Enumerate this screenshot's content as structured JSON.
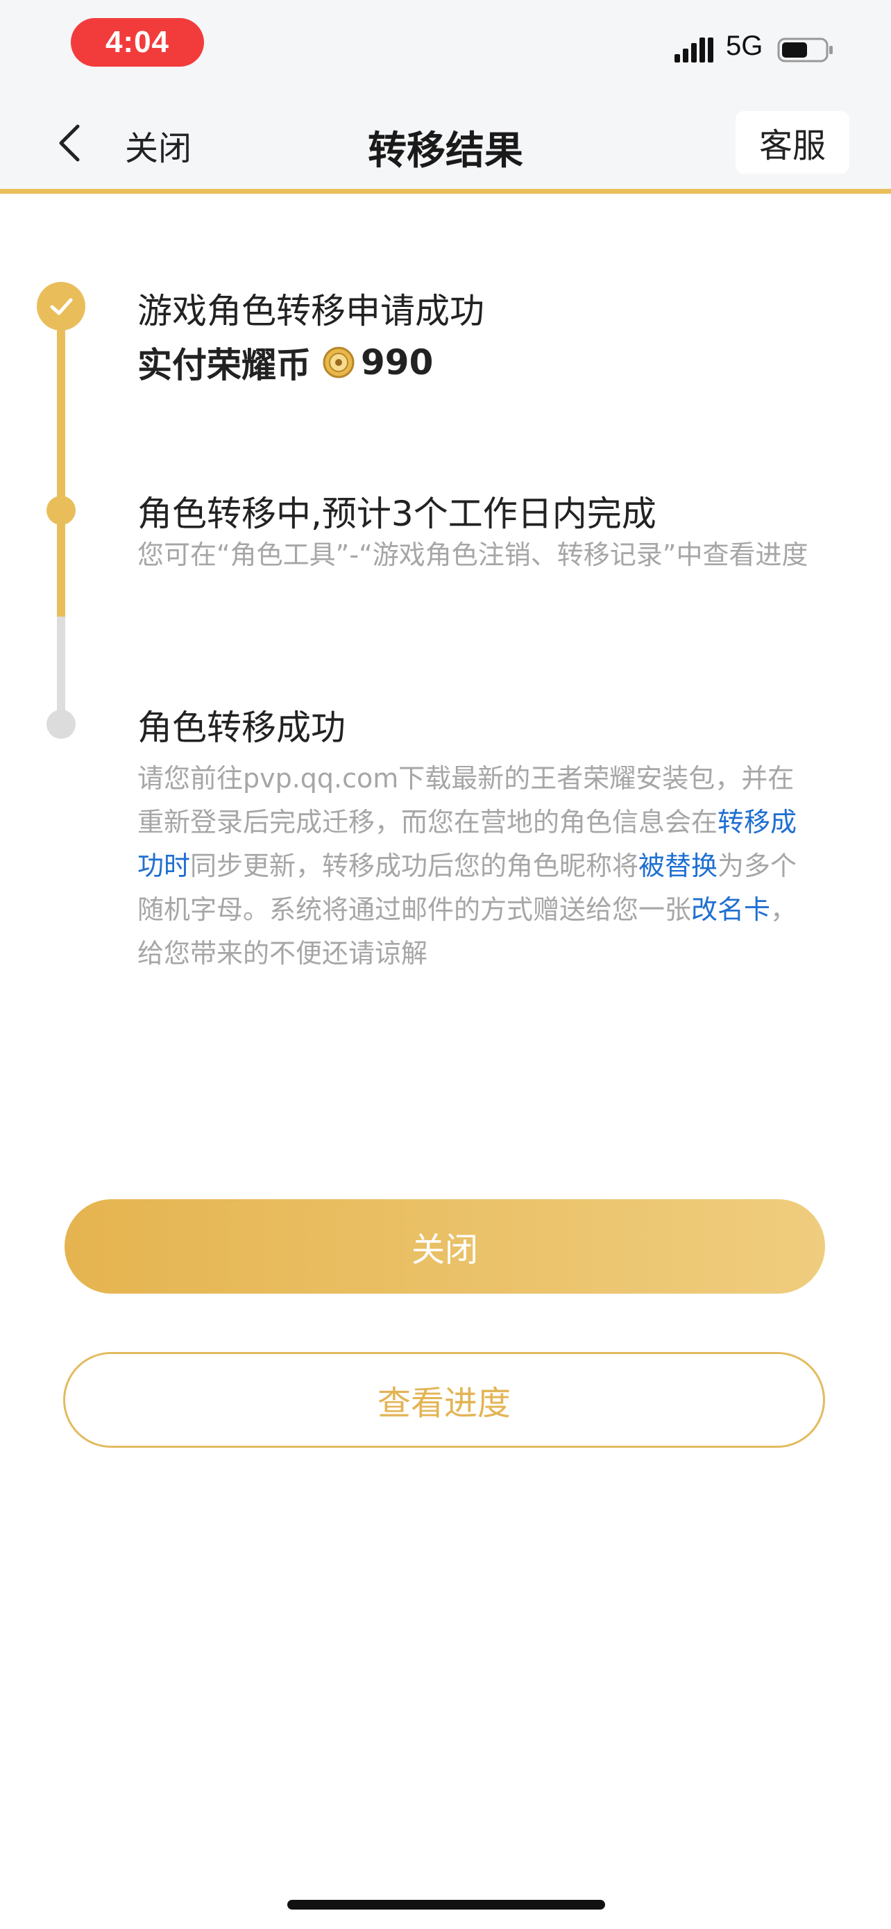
{
  "status_bar": {
    "time": "4:04",
    "network": "5G",
    "time_pill_color": "#f23c3c",
    "battery_level": 0.6
  },
  "nav": {
    "close_label": "关闭",
    "title": "转移结果",
    "service_label": "客服"
  },
  "accent_color": "#e9be5a",
  "link_color": "#1f6fd1",
  "timeline": {
    "step1": {
      "title": "游戏角色转移申请成功",
      "sub_label": "实付荣耀币",
      "amount": "990",
      "status": "done",
      "icon": "check-icon"
    },
    "step2": {
      "title": "角色转移中,预计3个工作日内完成",
      "desc": "您可在“角色工具”-“游戏角色注销、转移记录”中查看进度",
      "status": "current"
    },
    "step3": {
      "title": "角色转移成功",
      "desc_parts": [
        "请您前往pvp.qq.com下载最新的王者荣耀安装包，并在重新登录后完成迁移，而您在营地的角色信息会在",
        "转移成功时",
        "同步更新，转移成功后您的角色昵称将",
        "被替换",
        "为多个随机字母。系统将通过邮件的方式赠送给您一张",
        "改名卡",
        "，给您带来的不便还请谅解"
      ],
      "status": "pending"
    }
  },
  "buttons": {
    "primary_label": "关闭",
    "secondary_label": "查看进度"
  }
}
